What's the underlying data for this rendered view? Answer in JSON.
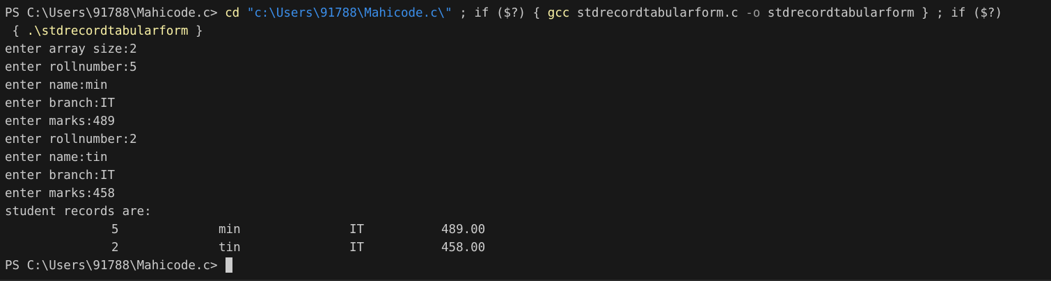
{
  "theme": {
    "background": "#181818",
    "foreground": "#cccccc",
    "command_color": "#f9f1a5",
    "string_color": "#3b8eea",
    "operator_color": "#9a9a9a",
    "variable_color": "#23d18b"
  },
  "command": {
    "prompt": "PS C:\\Users\\91788\\Mahicode.c> ",
    "cd": "cd",
    "path_string": "\"c:\\Users\\91788\\Mahicode.c\\\"",
    "sep1": " ; ",
    "if1": "if",
    "cond1": " ($?) ",
    "brace_open1": "{ ",
    "gcc": "gcc",
    "gcc_args": " stdrecordtabularform.c ",
    "flag_o": "-o",
    "gcc_out": " stdrecordtabularform } ",
    "sep2": "; ",
    "if2": "if",
    "cond2": " ($?)",
    "wrap_brace_open": " { ",
    "run_exe": ".\\stdrecordtabularform",
    "wrap_brace_close": " }"
  },
  "output_lines": [
    "enter array size:2",
    "enter rollnumber:5",
    "enter name:min",
    "enter branch:IT",
    "enter marks:489",
    "enter rollnumber:2",
    "enter name:tin",
    "enter branch:IT",
    "enter marks:458",
    "student records are:"
  ],
  "records": [
    {
      "roll": "5",
      "name": "min",
      "branch": "IT",
      "marks": "489.00"
    },
    {
      "roll": "2",
      "name": "tin",
      "branch": "IT",
      "marks": "458.00"
    }
  ],
  "final_prompt": "PS C:\\Users\\91788\\Mahicode.c> "
}
